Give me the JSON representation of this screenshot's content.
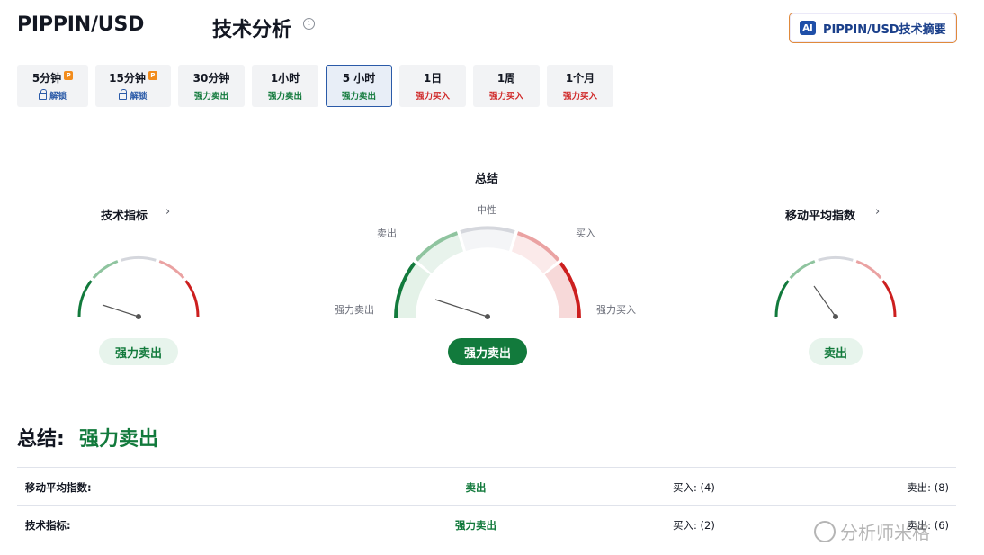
{
  "header": {
    "symbol": "PIPPIN/USD",
    "title": "技术分析",
    "info_glyph": "i",
    "ai_badge": "AI",
    "ai_button": "PIPPIN/USD技术摘要"
  },
  "tabs": [
    {
      "label": "5分钟",
      "sub": "解锁",
      "premium": true,
      "locked": true
    },
    {
      "label": "15分钟",
      "sub": "解锁",
      "premium": true,
      "locked": true
    },
    {
      "label": "30分钟",
      "sub": "强力卖出"
    },
    {
      "label": "1小时",
      "sub": "强力卖出"
    },
    {
      "label": "5 小时",
      "sub": "强力卖出",
      "active": true
    },
    {
      "label": "1日",
      "sub": "强力买入"
    },
    {
      "label": "1周",
      "sub": "强力买入"
    },
    {
      "label": "1个月",
      "sub": "强力买入"
    }
  ],
  "premium_glyph": "P",
  "gauges": {
    "left": {
      "title": "技术指标",
      "signal": "强力卖出"
    },
    "center": {
      "title": "总结",
      "signal": "强力卖出",
      "labels": {
        "neutral": "中性",
        "sell": "卖出",
        "buy": "买入",
        "strong_sell": "强力卖出",
        "strong_buy": "强力买入"
      }
    },
    "right": {
      "title": "移动平均指数",
      "signal": "卖出"
    },
    "chevron": "›"
  },
  "summary": {
    "label": "总结:",
    "value": "强力卖出",
    "rows": [
      {
        "name": "移动平均指数:",
        "signal": "卖出",
        "buy": "买入: (4)",
        "sell": "卖出: (8)"
      },
      {
        "name": "技术指标:",
        "signal": "强力卖出",
        "buy": "买入: (2)",
        "sell": "卖出: (6)"
      }
    ]
  },
  "colors": {
    "strong_sell": "#127a3c",
    "sell": "#8fc49f",
    "neutral": "#d5d7dd",
    "buy": "#eaa2a2",
    "strong_buy": "#cc1f1f",
    "buy_text": "#d02a2a"
  },
  "watermark": "分析师米格"
}
